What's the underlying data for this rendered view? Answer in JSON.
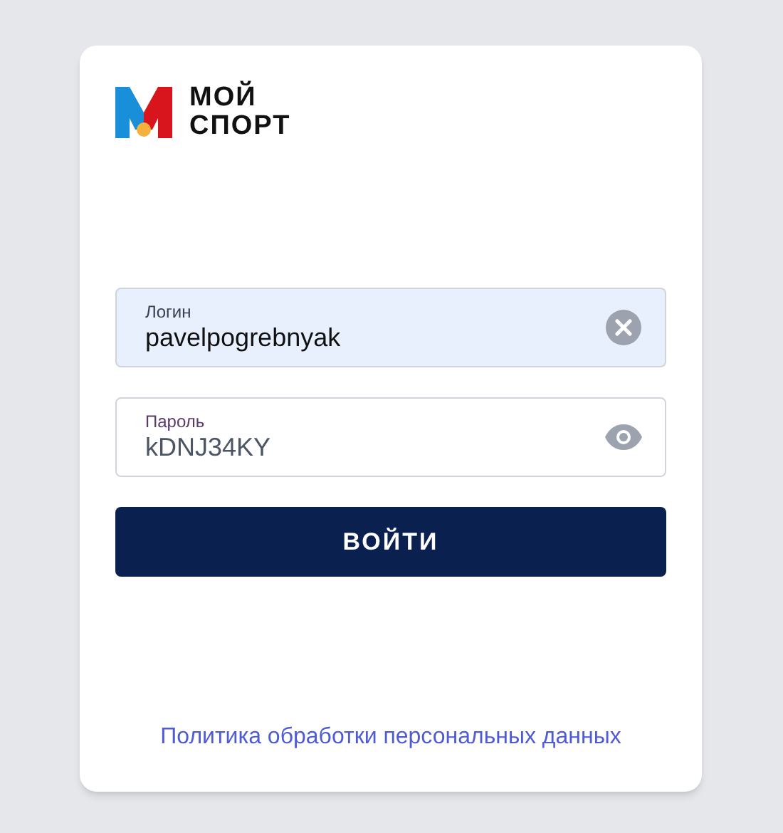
{
  "logo": {
    "lines": [
      "МОЙ",
      "СПОРТ"
    ]
  },
  "fields": [
    {
      "kind": "text",
      "label": "Логин",
      "value": "pavelpogrebnyak",
      "autofilled": true
    },
    {
      "kind": "password",
      "label": "Пароль",
      "value": "kDNJ34KY",
      "autofilled": false
    }
  ],
  "submit": {
    "label": "ВОЙТИ"
  },
  "footer_link": "Политика обработки персональных данных"
}
